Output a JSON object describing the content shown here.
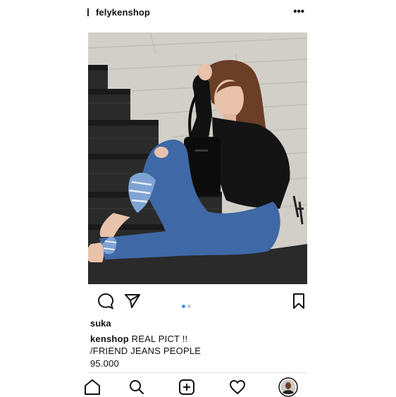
{
  "header": {
    "username": "felykenshop",
    "more_label": "•••"
  },
  "post": {
    "photo_alt_icon": "post-photo",
    "carousel": {
      "total": 2,
      "active": 1
    }
  },
  "likes_text": "suka",
  "caption": {
    "line1_user": "kenshop",
    "line1_text": " REAL PICT !!",
    "line2": "/FRIEND JEANS PEOPLE",
    "line3": "95.000",
    "line4": "_ _ _ _ _ _ _"
  },
  "icons": {
    "comment": "comment-icon",
    "share": "share-icon",
    "bookmark": "bookmark-icon",
    "home": "home-icon",
    "search": "search-icon",
    "add": "add-post-icon",
    "activity": "heart-icon",
    "profile": "profile-avatar"
  },
  "colors": {
    "carousel_active": "#3897f0",
    "carousel_inactive": "#c8c8c8",
    "text": "#111111"
  }
}
